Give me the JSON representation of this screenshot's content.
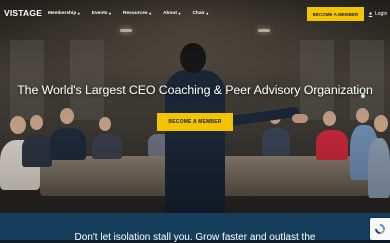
{
  "nav": {
    "logo": "VISTAGE",
    "items": [
      {
        "label": "Membership"
      },
      {
        "label": "Events"
      },
      {
        "label": "Resources"
      },
      {
        "label": "About"
      },
      {
        "label": "Chair"
      }
    ],
    "chevron": "▾",
    "cta_label": "BECOME A MEMBER",
    "login_label": "Login"
  },
  "hero": {
    "headline": "The World's Largest CEO Coaching & Peer Advisory Organization",
    "cta_label": "BECOME A MEMBER"
  },
  "band": {
    "text": "Don't let isolation stall you. Grow faster and outlast the"
  },
  "colors": {
    "accent": "#f5c400",
    "navy": "#13213a",
    "band": "#143e5b"
  },
  "icons": [
    "user-icon",
    "chevron-down-icon",
    "recaptcha-icon"
  ]
}
